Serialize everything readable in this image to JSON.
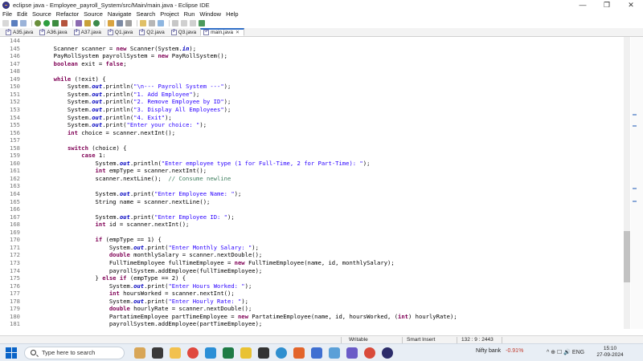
{
  "window": {
    "title": "eclipse java - Employee_payroll_System/src/Main/main.java - Eclipse IDE",
    "min_glyph": "—",
    "max_glyph": "❐",
    "close_glyph": "✕"
  },
  "menu": [
    "File",
    "Edit",
    "Source",
    "Refactor",
    "Source",
    "Navigate",
    "Search",
    "Project",
    "Run",
    "Window",
    "Help"
  ],
  "tabs": [
    {
      "label": "A35.java",
      "active": false
    },
    {
      "label": "A36.java",
      "active": false
    },
    {
      "label": "A37.java",
      "active": false
    },
    {
      "label": "Q1.java",
      "active": false
    },
    {
      "label": "Q2.java",
      "active": false
    },
    {
      "label": "Q3.java",
      "active": false
    },
    {
      "label": "main.java",
      "active": true
    }
  ],
  "editor": {
    "lines": [
      {
        "n": "144",
        "html": ""
      },
      {
        "n": "145",
        "html": "        Scanner scanner = <span class='kw'>new</span> Scanner(System.<span class='fld'>in</span>);"
      },
      {
        "n": "146",
        "html": "        PayRollSystem payrollSystem = <span class='kw'>new</span> PayRollSystem();"
      },
      {
        "n": "147",
        "html": "        <span class='kw'>boolean</span> exit = <span class='kw'>false</span>;"
      },
      {
        "n": "148",
        "html": ""
      },
      {
        "n": "149",
        "html": "        <span class='kw'>while</span> (!exit) {"
      },
      {
        "n": "150",
        "html": "            System.<span class='fld'>out</span>.println(<span class='str'>\"\\n--- Payroll System ---\"</span>);"
      },
      {
        "n": "151",
        "html": "            System.<span class='fld'>out</span>.println(<span class='str'>\"1. Add Employee\"</span>);"
      },
      {
        "n": "152",
        "html": "            System.<span class='fld'>out</span>.println(<span class='str'>\"2. Remove Employee by ID\"</span>);"
      },
      {
        "n": "153",
        "html": "            System.<span class='fld'>out</span>.println(<span class='str'>\"3. Display All Employees\"</span>);"
      },
      {
        "n": "154",
        "html": "            System.<span class='fld'>out</span>.println(<span class='str'>\"4. Exit\"</span>);"
      },
      {
        "n": "155",
        "html": "            System.<span class='fld'>out</span>.print(<span class='str'>\"Enter your choice: \"</span>);"
      },
      {
        "n": "156",
        "html": "            <span class='kw'>int</span> choice = scanner.nextInt();"
      },
      {
        "n": "157",
        "html": ""
      },
      {
        "n": "158",
        "html": "            <span class='kw'>switch</span> (choice) {"
      },
      {
        "n": "159",
        "html": "                <span class='kw'>case</span> 1:"
      },
      {
        "n": "160",
        "html": "                    System.<span class='fld'>out</span>.println(<span class='str'>\"Enter employee type (1 for Full-Time, 2 for Part-Time): \"</span>);"
      },
      {
        "n": "161",
        "html": "                    <span class='kw'>int</span> empType = scanner.nextInt();"
      },
      {
        "n": "162",
        "html": "                    scanner.nextLine();  <span class='cmt'>// Consume newline</span>"
      },
      {
        "n": "163",
        "html": ""
      },
      {
        "n": "164",
        "html": "                    System.<span class='fld'>out</span>.print(<span class='str'>\"Enter Employee Name: \"</span>);"
      },
      {
        "n": "165",
        "html": "                    String name = scanner.nextLine();"
      },
      {
        "n": "166",
        "html": ""
      },
      {
        "n": "167",
        "html": "                    System.<span class='fld'>out</span>.print(<span class='str'>\"Enter Employee ID: \"</span>);"
      },
      {
        "n": "168",
        "html": "                    <span class='kw'>int</span> id = scanner.nextInt();"
      },
      {
        "n": "169",
        "html": ""
      },
      {
        "n": "170",
        "html": "                    <span class='kw'>if</span> (empType == 1) {"
      },
      {
        "n": "171",
        "html": "                        System.<span class='fld'>out</span>.print(<span class='str'>\"Enter Monthly Salary: \"</span>);"
      },
      {
        "n": "172",
        "html": "                        <span class='kw'>double</span> monthlySalary = scanner.nextDouble();"
      },
      {
        "n": "173",
        "html": "                        FullTimeEmployee fullTimeEmployee = <span class='kw'>new</span> FullTimeEmployee(name, id, monthlySalary);"
      },
      {
        "n": "174",
        "html": "                        payrollSystem.addEmployee(fullTimeEmployee);"
      },
      {
        "n": "175",
        "html": "                    } <span class='kw'>else if</span> (empType == 2) {"
      },
      {
        "n": "176",
        "html": "                        System.<span class='fld'>out</span>.print(<span class='str'>\"Enter Hours Worked: \"</span>);"
      },
      {
        "n": "177",
        "html": "                        <span class='kw'>int</span> hoursWorked = scanner.nextInt();"
      },
      {
        "n": "178",
        "html": "                        System.<span class='fld'>out</span>.print(<span class='str'>\"Enter Hourly Rate: \"</span>);"
      },
      {
        "n": "179",
        "html": "                        <span class='kw'>double</span> hourlyRate = scanner.nextDouble();"
      },
      {
        "n": "180",
        "html": "                        PartatimeEmployee partTimeEmployee = <span class='kw'>new</span> PartatimeEmployee(name, id, hoursWorked, (<span class='kw'>int</span>) hourlyRate);"
      },
      {
        "n": "181",
        "html": "                        payrollSystem.addEmployee(partTimeEmployee);"
      }
    ]
  },
  "status": {
    "mode": "Writable",
    "insert": "Smart Insert",
    "position": "132 : 9 : 2443"
  },
  "taskbar": {
    "search_placeholder": "Type here to search",
    "ticker_name": "Nifty bank",
    "ticker_change": "-0.91%",
    "tray_text": "^  ⊕  ☐  🔊  ENG",
    "time": "15:10",
    "date": "27-09-2024"
  },
  "colors": {
    "keyword": "#7f0055",
    "string": "#2a00ff",
    "field": "#0000c0",
    "comment": "#3f7f5f",
    "accent": "#2f6ec7"
  }
}
